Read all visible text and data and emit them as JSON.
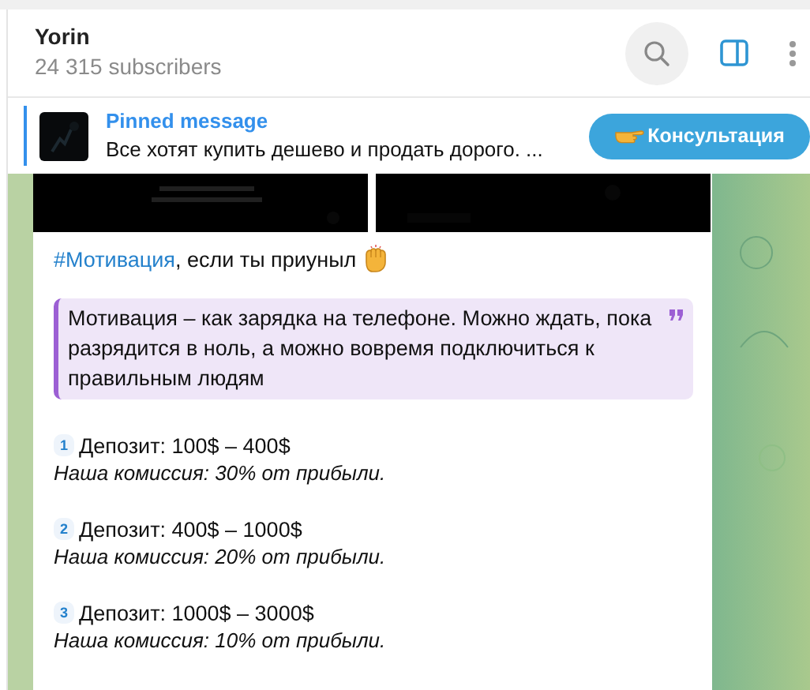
{
  "header": {
    "title": "Yorin",
    "subtitle": "24 315 subscribers"
  },
  "pinned": {
    "title": "Pinned message",
    "text": "Все хотят купить дешево и продать дорого. ...",
    "button": "Консультация"
  },
  "message": {
    "hashtag": "#Мотивация",
    "caption": ", если ты приуныл",
    "quote": "Мотивация – как зарядка на телефоне. Можно ждать, пока разрядится в ноль, а можно вовремя подключиться к правильным людям",
    "items": [
      {
        "number": "1",
        "title": "Депозит: 100$ – 400$",
        "note": "Наша комиссия: 30% от прибыли."
      },
      {
        "number": "2",
        "title": "Депозит: 400$ – 1000$",
        "note": "Наша комиссия: 20% от прибыли."
      },
      {
        "number": "3",
        "title": "Депозит: 1000$ – 3000$",
        "note": "Наша комиссия: 10% от прибыли."
      }
    ]
  }
}
